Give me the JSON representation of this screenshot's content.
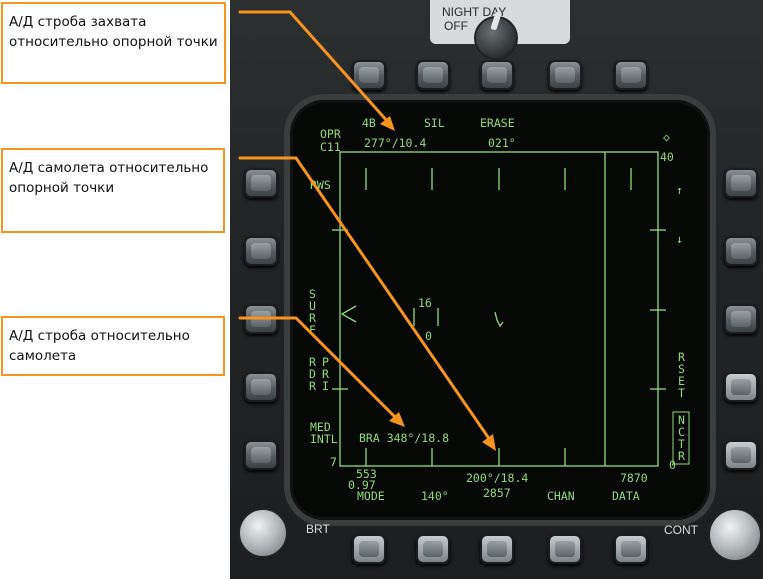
{
  "callouts": [
    "А/Д строба захвата относительно опорной точки",
    "А/Д самолета относительно опорной точки",
    "А/Д строба относительно самолета"
  ],
  "panel": {
    "night_day_label": "NIGHT  DAY",
    "off_label": "OFF",
    "brt_label": "BRT",
    "cont_label": "CONT"
  },
  "display": {
    "top": {
      "opr": "OPR",
      "scan": "4B",
      "sil": "SIL",
      "erase": "ERASE"
    },
    "line2": {
      "code": "C11",
      "cursor_bra": "277°/10.4",
      "heading": "021°"
    },
    "range_top": "40",
    "range_bottom": "0",
    "left": {
      "rws": "RWS",
      "surf": "SURF",
      "rdr": "RDR",
      "pri": "PRI",
      "med": "MED",
      "intl": "INTL",
      "seven": "7"
    },
    "right": {
      "diamond": "◇",
      "up": "↑",
      "down": "↓",
      "rset": "RSET",
      "nctr": "NCTR"
    },
    "target": {
      "alt_top": "16",
      "alt_bottom": "0"
    },
    "bra_label": "BRA 348°/18.8",
    "bottom_left_top": "553",
    "bottom_left_bot": "0.97",
    "bullseye_bra": "200°/18.4",
    "bottom_right": "7870",
    "bottom_center": "2857",
    "mode": "MODE",
    "azimuth": "140°",
    "chan": "CHAN",
    "data": "DATA"
  },
  "colors": {
    "symbology": "#8fdc76",
    "callout_border": "#f7941d",
    "arrow": "#f7941d"
  }
}
